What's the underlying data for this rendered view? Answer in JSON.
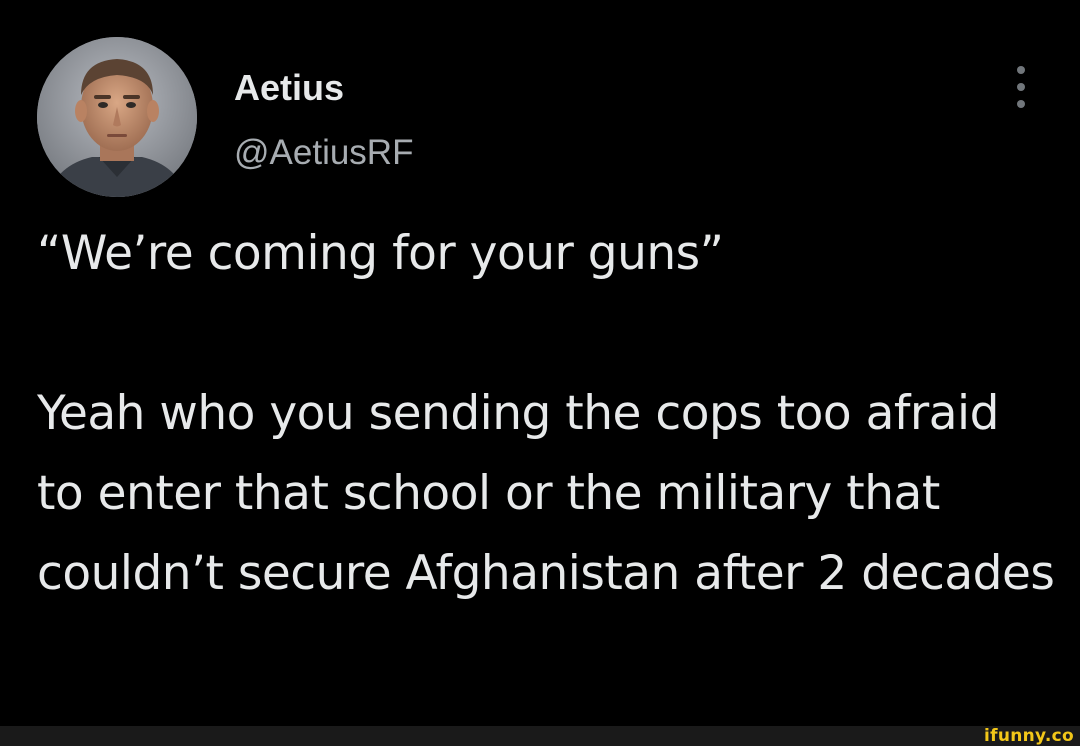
{
  "tweet": {
    "author": {
      "display_name": "Aetius",
      "handle": "@AetiusRF",
      "avatar": "profile-photo"
    },
    "more_icon": "more-vertical-icon",
    "text": "“We’re coming for your guns”\n\nYeah who you sending the cops too afraid to enter that school or the military that couldn’t secure Afghanistan after 2 decades"
  },
  "watermark": {
    "text": "ifunny.co",
    "color": "#f2c719"
  },
  "colors": {
    "background": "#000000",
    "primary_text": "#e7e9ea",
    "secondary_text": "#a7acb1",
    "footer_bar": "#1a1a1a"
  }
}
